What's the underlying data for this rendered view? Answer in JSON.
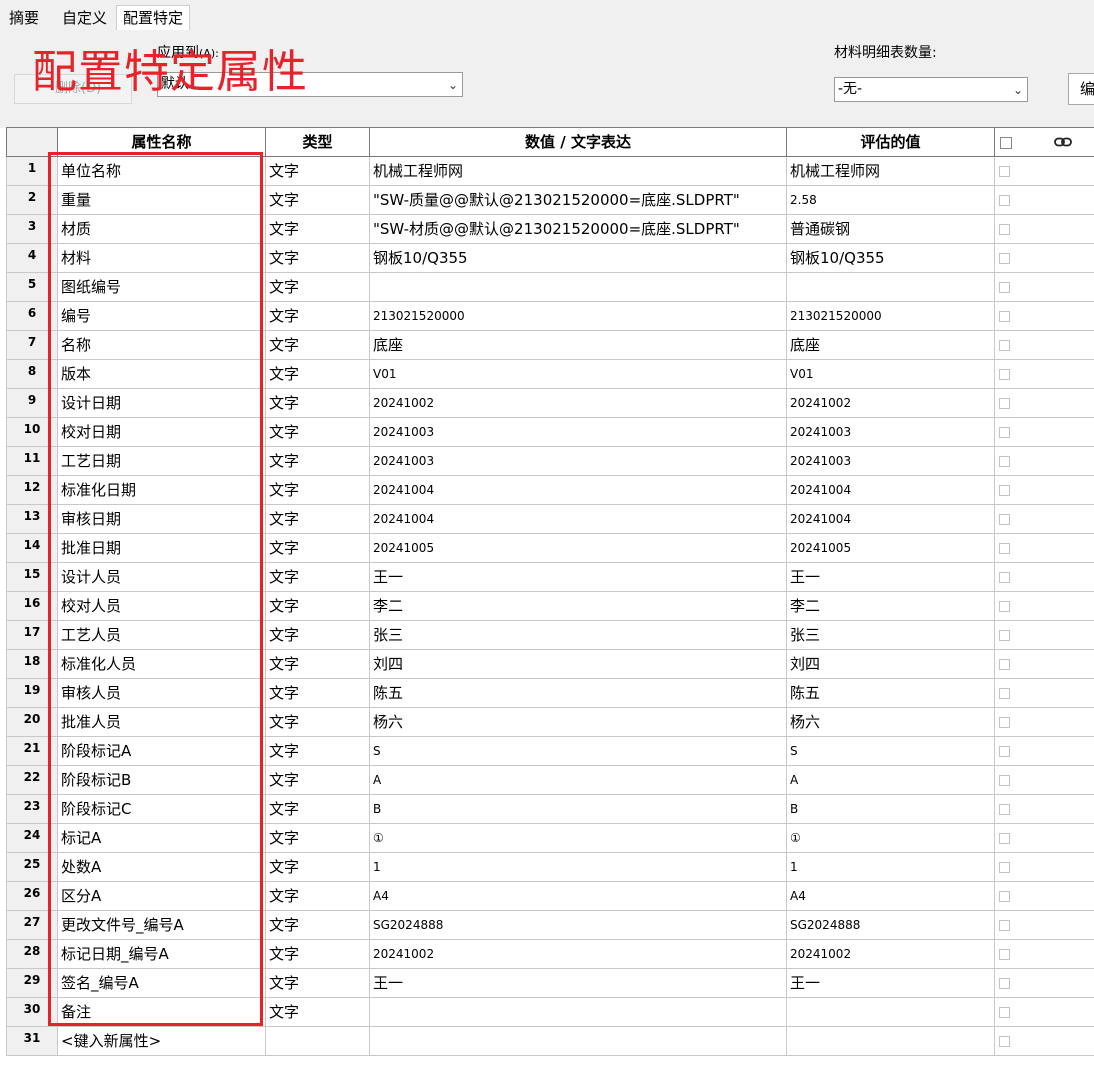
{
  "tabs": [
    {
      "label": "摘要",
      "active": false
    },
    {
      "label": "自定义",
      "active": false
    },
    {
      "label": "配置特定",
      "active": true
    }
  ],
  "toolbar": {
    "apply_to_label": "应用到",
    "apply_to_hotkey": "(A):",
    "delete_label": "删除(D)",
    "config_value": "默认",
    "bom_qty_label": "材料明细表数量:",
    "bom_qty_value": "-无-",
    "edit_label": "编"
  },
  "overlay": {
    "title": "配置特定属性",
    "color": "#e8222a"
  },
  "grid": {
    "headers": {
      "name": "属性名称",
      "type": "类型",
      "value": "数值 / 文字表达",
      "evaluated": "评估的值"
    },
    "icons": {
      "header_link": "chain-link-icon"
    },
    "rows": [
      {
        "num": "1",
        "name": "单位名称",
        "type": "文字",
        "value": "机械工程师网",
        "evaluated": "机械工程师网"
      },
      {
        "num": "2",
        "name": "重量",
        "type": "文字",
        "value": "\"SW-质量@@默认@213021520000=底座.SLDPRT\"",
        "evaluated": "2.58"
      },
      {
        "num": "3",
        "name": "材质",
        "type": "文字",
        "value": "\"SW-材质@@默认@213021520000=底座.SLDPRT\"",
        "evaluated": "普通碳钢"
      },
      {
        "num": "4",
        "name": "材料",
        "type": "文字",
        "value": "钢板10/Q355",
        "evaluated": "钢板10/Q355"
      },
      {
        "num": "5",
        "name": "图纸编号",
        "type": "文字",
        "value": "",
        "evaluated": ""
      },
      {
        "num": "6",
        "name": "编号",
        "type": "文字",
        "value": "213021520000",
        "evaluated": "213021520000"
      },
      {
        "num": "7",
        "name": "名称",
        "type": "文字",
        "value": "底座",
        "evaluated": "底座"
      },
      {
        "num": "8",
        "name": "版本",
        "type": "文字",
        "value": "V01",
        "evaluated": "V01"
      },
      {
        "num": "9",
        "name": "设计日期",
        "type": "文字",
        "value": "20241002",
        "evaluated": "20241002"
      },
      {
        "num": "10",
        "name": "校对日期",
        "type": "文字",
        "value": "20241003",
        "evaluated": "20241003"
      },
      {
        "num": "11",
        "name": "工艺日期",
        "type": "文字",
        "value": "20241003",
        "evaluated": "20241003"
      },
      {
        "num": "12",
        "name": "标准化日期",
        "type": "文字",
        "value": "20241004",
        "evaluated": "20241004"
      },
      {
        "num": "13",
        "name": "审核日期",
        "type": "文字",
        "value": "20241004",
        "evaluated": "20241004"
      },
      {
        "num": "14",
        "name": "批准日期",
        "type": "文字",
        "value": "20241005",
        "evaluated": "20241005"
      },
      {
        "num": "15",
        "name": "设计人员",
        "type": "文字",
        "value": "王一",
        "evaluated": "王一"
      },
      {
        "num": "16",
        "name": "校对人员",
        "type": "文字",
        "value": "李二",
        "evaluated": "李二"
      },
      {
        "num": "17",
        "name": "工艺人员",
        "type": "文字",
        "value": "张三",
        "evaluated": "张三"
      },
      {
        "num": "18",
        "name": "标准化人员",
        "type": "文字",
        "value": "刘四",
        "evaluated": "刘四"
      },
      {
        "num": "19",
        "name": "审核人员",
        "type": "文字",
        "value": "陈五",
        "evaluated": "陈五"
      },
      {
        "num": "20",
        "name": "批准人员",
        "type": "文字",
        "value": "杨六",
        "evaluated": "杨六"
      },
      {
        "num": "21",
        "name": "阶段标记A",
        "type": "文字",
        "value": "S",
        "evaluated": "S"
      },
      {
        "num": "22",
        "name": "阶段标记B",
        "type": "文字",
        "value": "A",
        "evaluated": "A"
      },
      {
        "num": "23",
        "name": "阶段标记C",
        "type": "文字",
        "value": "B",
        "evaluated": "B"
      },
      {
        "num": "24",
        "name": "标记A",
        "type": "文字",
        "value": "①",
        "evaluated": "①"
      },
      {
        "num": "25",
        "name": "处数A",
        "type": "文字",
        "value": "1",
        "evaluated": "1"
      },
      {
        "num": "26",
        "name": "区分A",
        "type": "文字",
        "value": "A4",
        "evaluated": "A4"
      },
      {
        "num": "27",
        "name": "更改文件号_编号A",
        "type": "文字",
        "value": "SG2024888",
        "evaluated": "SG2024888"
      },
      {
        "num": "28",
        "name": "标记日期_编号A",
        "type": "文字",
        "value": "20241002",
        "evaluated": "20241002"
      },
      {
        "num": "29",
        "name": "签名_编号A",
        "type": "文字",
        "value": "王一",
        "evaluated": "王一"
      },
      {
        "num": "30",
        "name": "备注",
        "type": "文字",
        "value": "",
        "evaluated": ""
      },
      {
        "num": "31",
        "name": "<键入新属性>",
        "type": "",
        "value": "",
        "evaluated": ""
      }
    ]
  }
}
